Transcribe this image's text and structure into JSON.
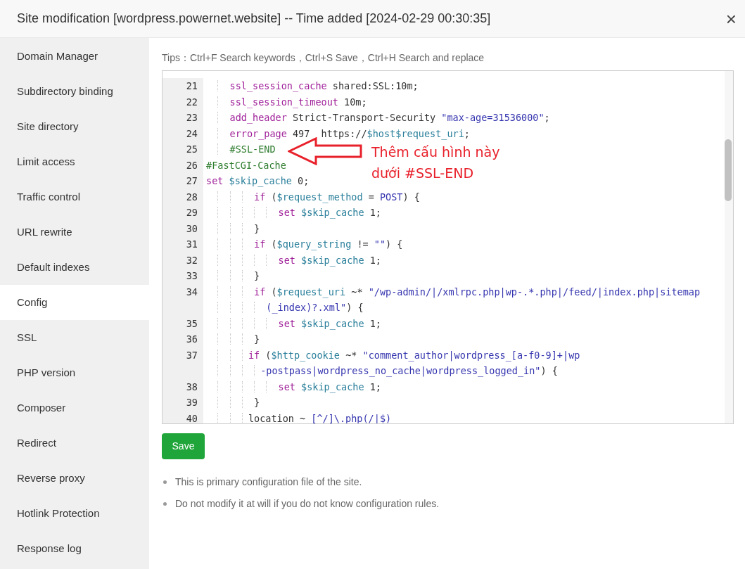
{
  "window": {
    "title": "Site modification [wordpress.powernet.website] -- Time added [2024-02-29 00:30:35]",
    "close": "×"
  },
  "sidebar": {
    "items": [
      {
        "label": "Domain Manager",
        "selected": false
      },
      {
        "label": "Subdirectory binding",
        "selected": false
      },
      {
        "label": "Site directory",
        "selected": false
      },
      {
        "label": "Limit access",
        "selected": false
      },
      {
        "label": "Traffic control",
        "selected": false
      },
      {
        "label": "URL rewrite",
        "selected": false
      },
      {
        "label": "Default indexes",
        "selected": false
      },
      {
        "label": "Config",
        "selected": true
      },
      {
        "label": "SSL",
        "selected": false
      },
      {
        "label": "PHP version",
        "selected": false
      },
      {
        "label": "Composer",
        "selected": false
      },
      {
        "label": "Redirect",
        "selected": false
      },
      {
        "label": "Reverse proxy",
        "selected": false
      },
      {
        "label": "Hotlink Protection",
        "selected": false
      },
      {
        "label": "Response log",
        "selected": false
      }
    ]
  },
  "tips": "Tips：Ctrl+F Search keywords，Ctrl+S Save，Ctrl+H Search and replace",
  "editor": {
    "lines": [
      {
        "number": "21",
        "tokens": [
          {
            "kind": "keyword",
            "text": "    ssl_session_cache"
          },
          {
            "kind": "plain",
            "text": " shared:SSL:10m;"
          }
        ]
      },
      {
        "number": "22",
        "tokens": [
          {
            "kind": "keyword",
            "text": "    ssl_session_timeout"
          },
          {
            "kind": "plain",
            "text": " 10m;"
          }
        ]
      },
      {
        "number": "23",
        "tokens": [
          {
            "kind": "keyword",
            "text": "    add_header"
          },
          {
            "kind": "plain",
            "text": " Strict-Transport-Security "
          },
          {
            "kind": "string",
            "text": "\"max-age=31536000\""
          },
          {
            "kind": "plain",
            "text": ";"
          }
        ]
      },
      {
        "number": "24",
        "tokens": [
          {
            "kind": "keyword",
            "text": "    error_page"
          },
          {
            "kind": "plain",
            "text": " 497  https://"
          },
          {
            "kind": "variable",
            "text": "$host$request_uri"
          },
          {
            "kind": "plain",
            "text": ";"
          }
        ]
      },
      {
        "number": "25",
        "tokens": [
          {
            "kind": "comment",
            "text": "    #SSL-END"
          }
        ]
      },
      {
        "number": "26",
        "tokens": [
          {
            "kind": "comment",
            "text": "#FastCGI-Cache"
          }
        ]
      },
      {
        "number": "27",
        "tokens": [
          {
            "kind": "keyword",
            "text": "set"
          },
          {
            "kind": "variable",
            "text": " $skip_cache"
          },
          {
            "kind": "plain",
            "text": " 0;"
          }
        ]
      },
      {
        "number": "28",
        "tokens": [
          {
            "kind": "keyword",
            "text": "        if"
          },
          {
            "kind": "plain",
            "text": " ("
          },
          {
            "kind": "variable",
            "text": "$request_method"
          },
          {
            "kind": "plain",
            "text": " = "
          },
          {
            "kind": "string",
            "text": "POST"
          },
          {
            "kind": "plain",
            "text": ") {"
          }
        ]
      },
      {
        "number": "29",
        "tokens": [
          {
            "kind": "keyword",
            "text": "            set"
          },
          {
            "kind": "variable",
            "text": " $skip_cache"
          },
          {
            "kind": "plain",
            "text": " 1;"
          }
        ]
      },
      {
        "number": "30",
        "tokens": [
          {
            "kind": "plain",
            "text": "        }"
          }
        ]
      },
      {
        "number": "31",
        "tokens": [
          {
            "kind": "keyword",
            "text": "        if"
          },
          {
            "kind": "plain",
            "text": " ("
          },
          {
            "kind": "variable",
            "text": "$query_string"
          },
          {
            "kind": "plain",
            "text": " != "
          },
          {
            "kind": "string",
            "text": "\"\""
          },
          {
            "kind": "plain",
            "text": ") {"
          }
        ]
      },
      {
        "number": "32",
        "tokens": [
          {
            "kind": "keyword",
            "text": "            set"
          },
          {
            "kind": "variable",
            "text": " $skip_cache"
          },
          {
            "kind": "plain",
            "text": " 1;"
          }
        ]
      },
      {
        "number": "33",
        "tokens": [
          {
            "kind": "plain",
            "text": "        }"
          }
        ]
      },
      {
        "number": "34",
        "tokens": [
          {
            "kind": "keyword",
            "text": "        if"
          },
          {
            "kind": "plain",
            "text": " ("
          },
          {
            "kind": "variable",
            "text": "$request_uri"
          },
          {
            "kind": "plain",
            "text": " ~* "
          },
          {
            "kind": "string",
            "text": "\"/wp-admin/|/xmlrpc.php|wp-.*.php|/feed/|index.php|sitemap"
          }
        ]
      },
      {
        "tokens": [
          {
            "kind": "string",
            "text": "          (_index)?.xml\""
          },
          {
            "kind": "plain",
            "text": ") {"
          }
        ]
      },
      {
        "number": "35",
        "tokens": [
          {
            "kind": "keyword",
            "text": "            set"
          },
          {
            "kind": "variable",
            "text": " $skip_cache"
          },
          {
            "kind": "plain",
            "text": " 1;"
          }
        ]
      },
      {
        "number": "36",
        "tokens": [
          {
            "kind": "plain",
            "text": "        }"
          }
        ]
      },
      {
        "number": "37",
        "tokens": [
          {
            "kind": "keyword",
            "text": "       if"
          },
          {
            "kind": "plain",
            "text": " ("
          },
          {
            "kind": "variable",
            "text": "$http_cookie"
          },
          {
            "kind": "plain",
            "text": " ~* "
          },
          {
            "kind": "string",
            "text": "\"comment_author|wordpress_[a-f0-9]+|wp"
          }
        ]
      },
      {
        "tokens": [
          {
            "kind": "string",
            "text": "         -postpass|wordpress_no_cache|wordpress_logged_in\""
          },
          {
            "kind": "plain",
            "text": ") {"
          }
        ]
      },
      {
        "number": "38",
        "tokens": [
          {
            "kind": "keyword",
            "text": "            set"
          },
          {
            "kind": "variable",
            "text": " $skip_cache"
          },
          {
            "kind": "plain",
            "text": " 1;"
          }
        ]
      },
      {
        "number": "39",
        "tokens": [
          {
            "kind": "plain",
            "text": "        }"
          }
        ]
      },
      {
        "number": "40",
        "tokens": [
          {
            "kind": "plain",
            "text": "       location ~ "
          },
          {
            "kind": "string",
            "text": "[^/]\\.php(/|$)"
          }
        ]
      }
    ]
  },
  "annotation": {
    "lines": [
      "Thêm cấu hình này",
      "dưới #SSL-END"
    ]
  },
  "save_button": "Save",
  "notes": [
    "This is primary configuration file of the site.",
    "Do not modify it at will if you do not know configuration rules."
  ]
}
